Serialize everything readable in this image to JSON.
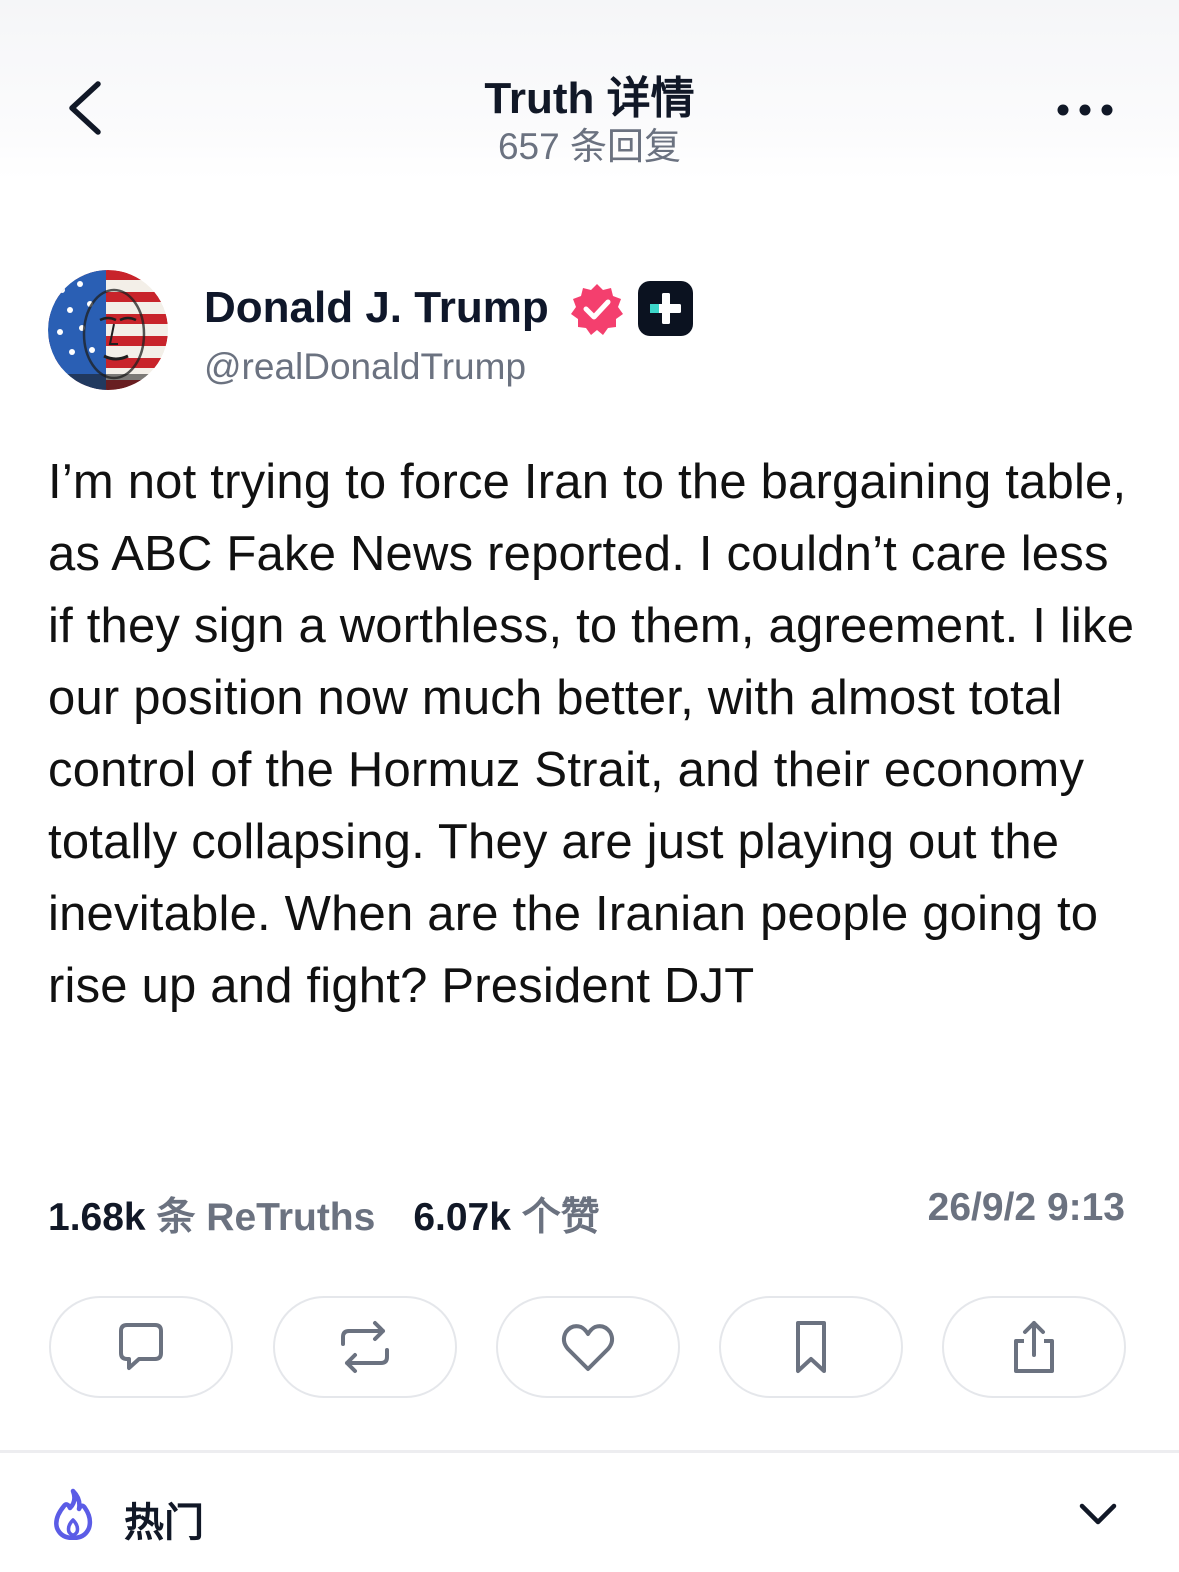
{
  "header": {
    "title": "Truth 详情",
    "subtitle": "657 条回复"
  },
  "author": {
    "display_name": "Donald J. Trump",
    "handle": "@realDonaldTrump",
    "verified": true,
    "badge": "plus-badge"
  },
  "post": {
    "text": "I’m not trying to force Iran to the bargaining table, as ABC Fake News reported. I couldn’t care less if they sign a worthless, to them, agreement. I like our position now much better, with almost total control of the Hormuz Strait, and their economy totally collapsing. They are just playing out the inevitable. When are the Iranian people going to rise up and fight? President DJT"
  },
  "stats": {
    "retruths_count": "1.68k",
    "retruths_label": "条 ReTruths",
    "likes_count": "6.07k",
    "likes_label": "个赞",
    "timestamp": "26/9/2 9:13"
  },
  "actions": [
    "reply-icon",
    "retruth-icon",
    "heart-icon",
    "bookmark-icon",
    "share-icon"
  ],
  "sort": {
    "label": "热门",
    "icon": "flame-icon"
  },
  "colors": {
    "accent_purple": "#5b5ce6",
    "verified_pink": "#f43f6e",
    "text_primary": "#0f172a",
    "text_secondary": "#6b7280"
  }
}
